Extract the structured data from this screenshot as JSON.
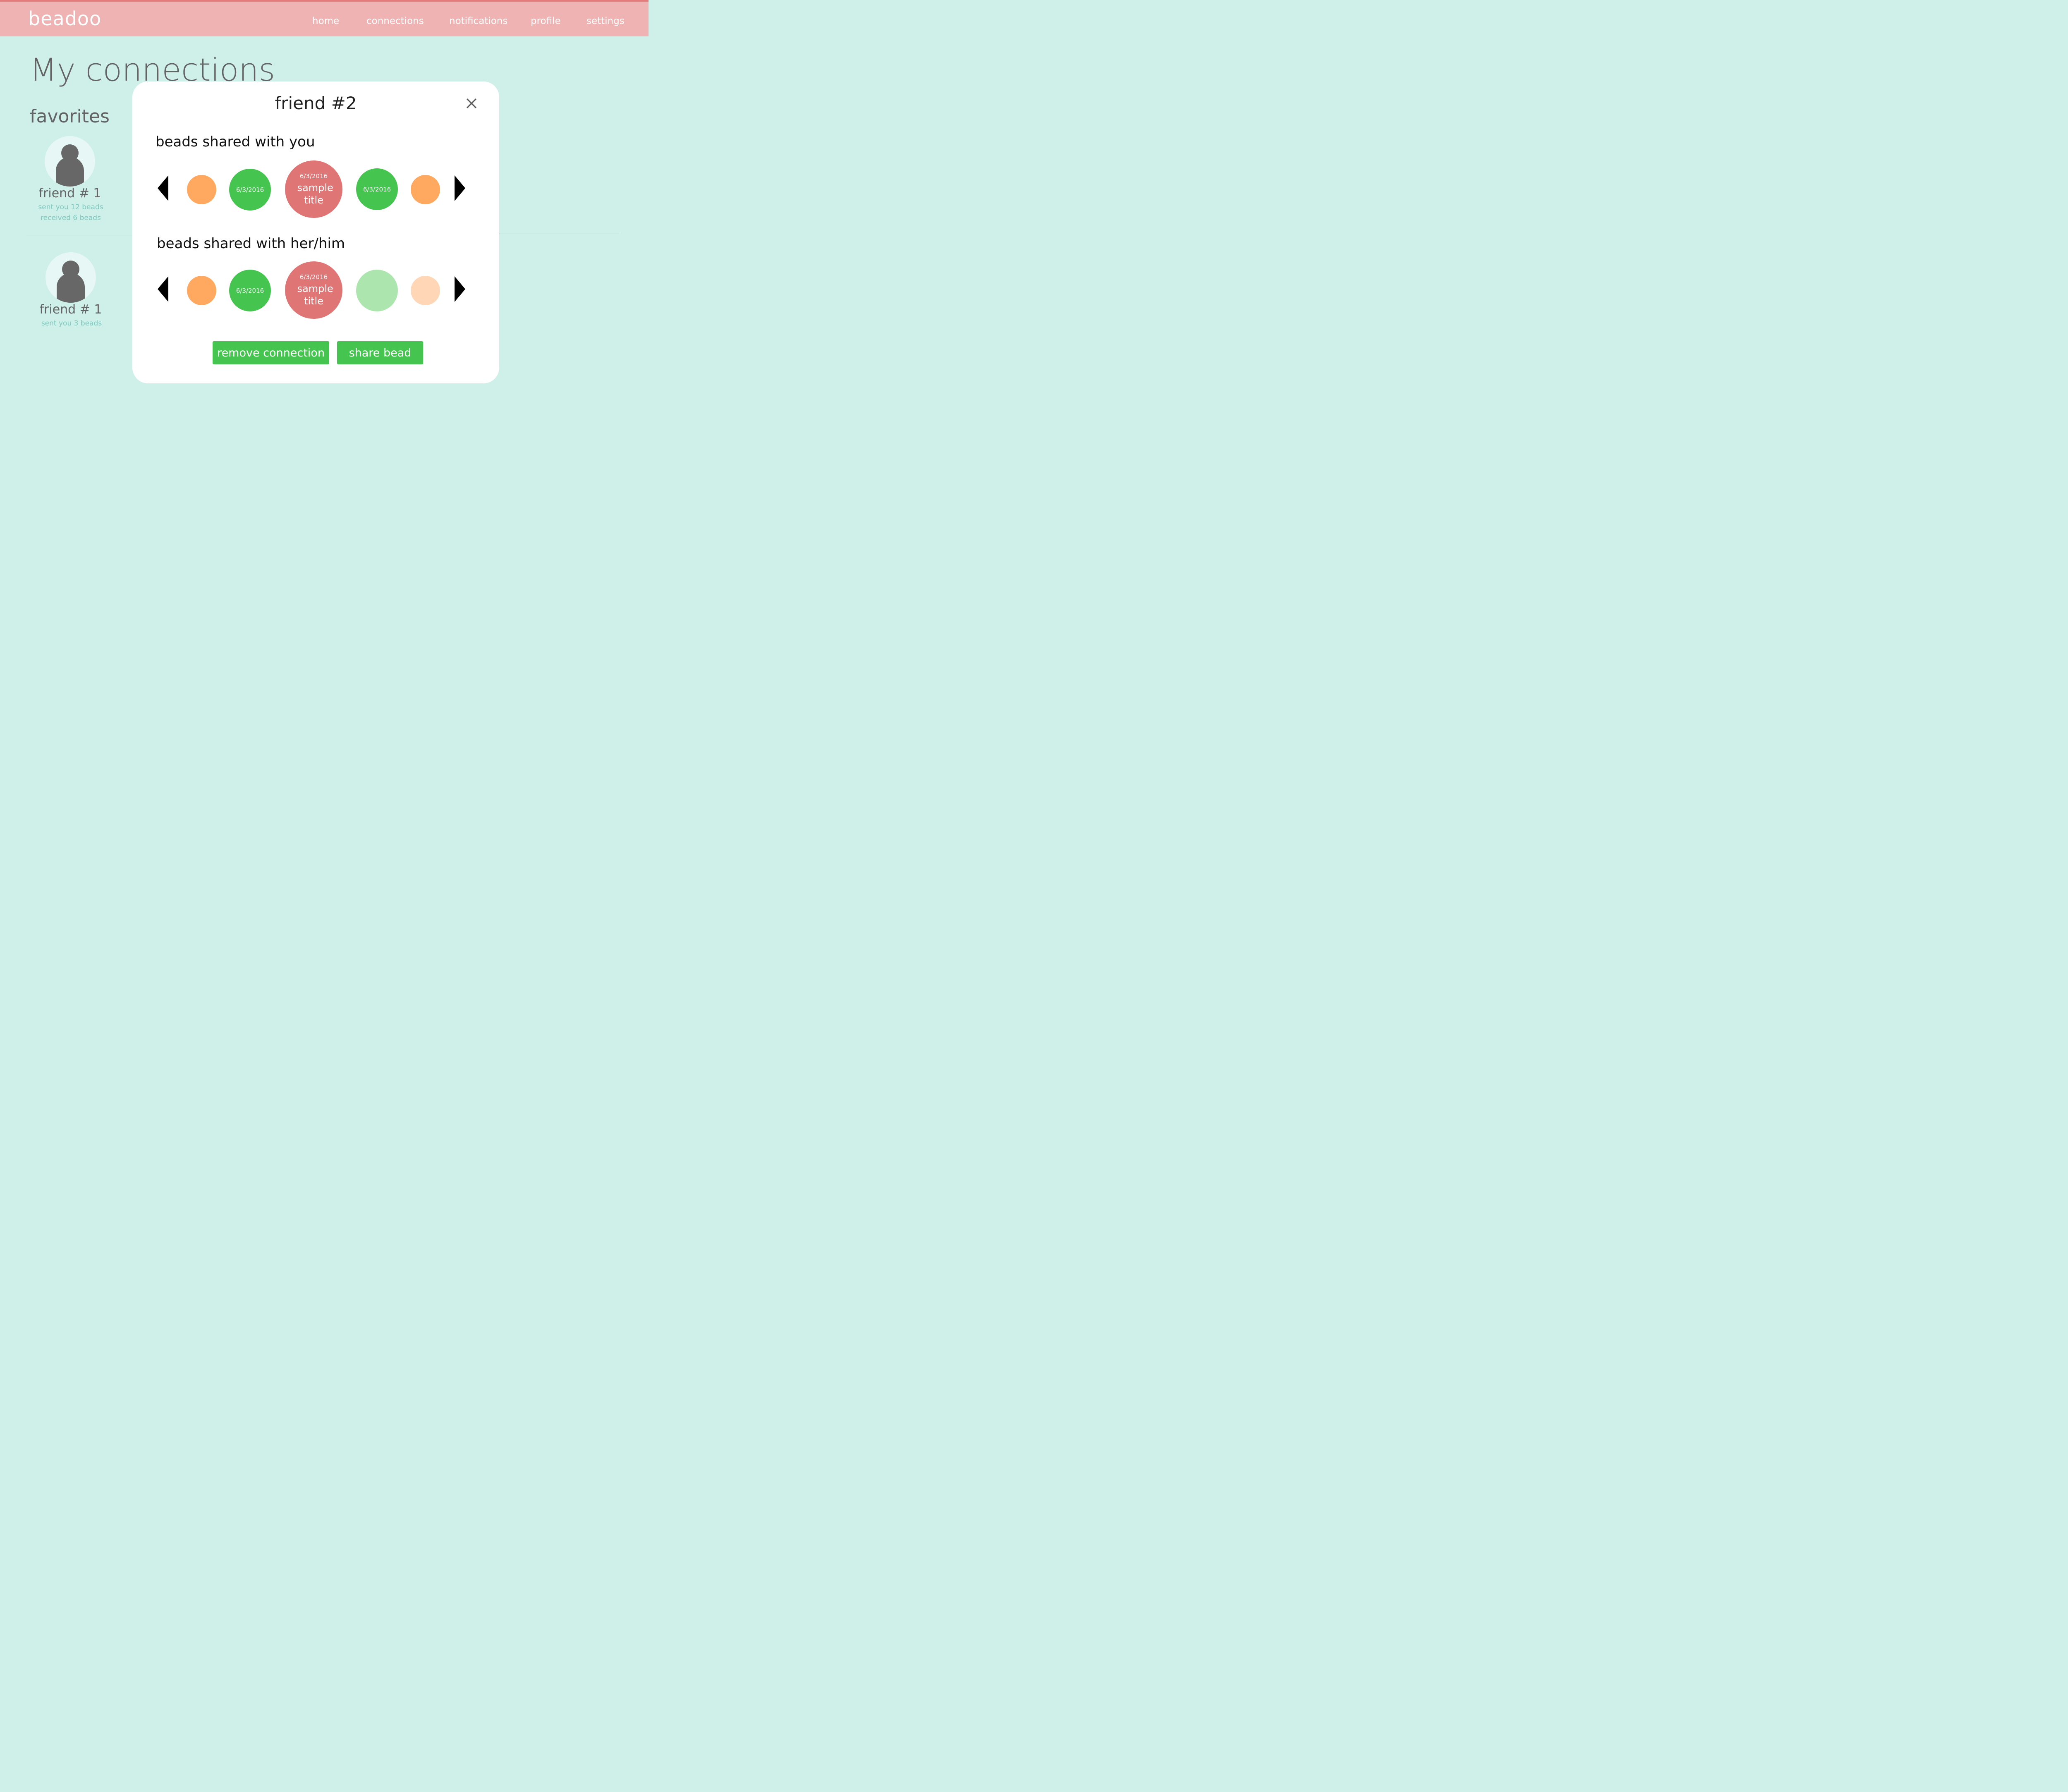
{
  "header": {
    "logo": "beadoo",
    "nav": [
      "home",
      "connections",
      "notifications",
      "profile",
      "settings"
    ]
  },
  "page": {
    "title": "My connections",
    "section": "favorites"
  },
  "friends": [
    {
      "name": "friend # 1",
      "stats": [
        "sent you 12 beads",
        "received 6 beads"
      ]
    },
    {
      "name": "friend # 1",
      "stats": [
        "sent you 3 beads"
      ]
    }
  ],
  "modal": {
    "title": "friend #2",
    "close_icon": "close-icon",
    "rows": [
      {
        "title": "beads shared with you",
        "beads": [
          {
            "color": "#ffa860",
            "date": "",
            "title": ""
          },
          {
            "color": "#45c550",
            "date": "6/3/2016",
            "title": ""
          },
          {
            "color": "#e07575",
            "date": "6/3/2016",
            "title": "sample title"
          },
          {
            "color": "#45c550",
            "date": "6/3/2016",
            "title": ""
          },
          {
            "color": "#ffa860",
            "date": "",
            "title": ""
          }
        ]
      },
      {
        "title": "beads shared with her/him",
        "beads": [
          {
            "color": "#ffa860",
            "date": "",
            "title": ""
          },
          {
            "color": "#45c550",
            "date": "6/3/2016",
            "title": ""
          },
          {
            "color": "#e07575",
            "date": "6/3/2016",
            "title": "sample title"
          },
          {
            "color": "#ace6ae",
            "date": "",
            "title": ""
          },
          {
            "color": "#ffd6b6",
            "date": "",
            "title": ""
          }
        ]
      }
    ],
    "buttons": {
      "remove": "remove connection",
      "share": "share bead"
    }
  },
  "colors": {
    "header": "#efb3b3",
    "background": "#cfefe9",
    "accent_green": "#45c550",
    "stat_text": "#7cc9c0"
  }
}
